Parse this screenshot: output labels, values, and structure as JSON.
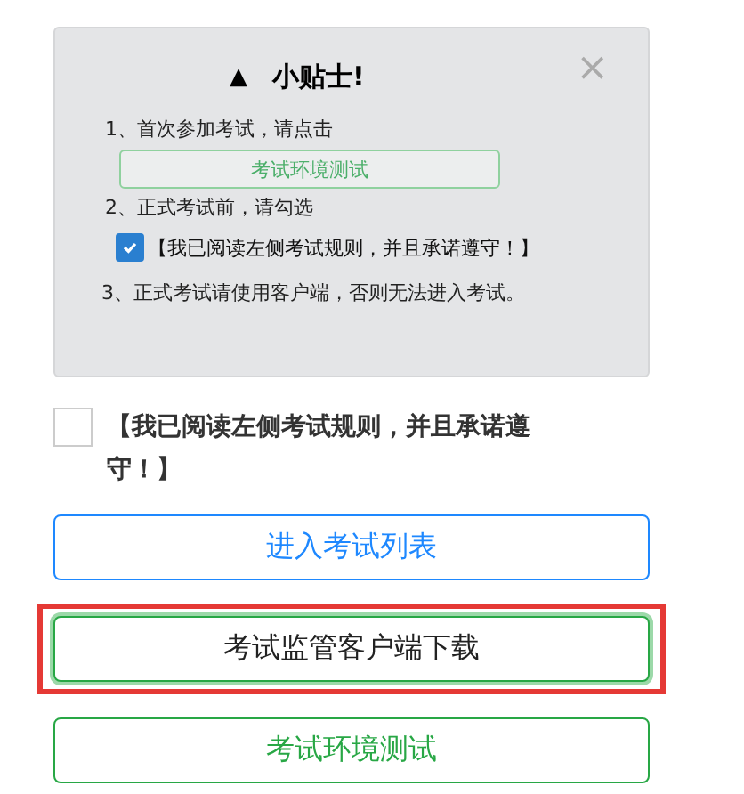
{
  "tips": {
    "icon": "▲",
    "title": "小贴士!",
    "close": "×",
    "steps": [
      {
        "kind": "text",
        "text": "1、首次参加考试，请点击"
      },
      {
        "kind": "button",
        "text": "考试环境测试"
      },
      {
        "kind": "text",
        "text": "2、正式考试前，请勾选"
      },
      {
        "kind": "checkbox",
        "text": "【我已阅读左侧考试规则，并且承诺遵守！】",
        "checked": true
      },
      {
        "kind": "note",
        "text": "3、正式考试请使用客户端，否则无法进入考试。"
      }
    ]
  },
  "agree": {
    "text": "【我已阅读左侧考试规则，并且承诺遵守！】",
    "checked": false
  },
  "buttons": [
    {
      "text": "进入考试列表",
      "kind": "primary",
      "highlighted": false
    },
    {
      "text": "考试监管客户端下载",
      "kind": "default",
      "highlighted": true
    },
    {
      "text": "考试环境测试",
      "kind": "success",
      "highlighted": false
    }
  ]
}
